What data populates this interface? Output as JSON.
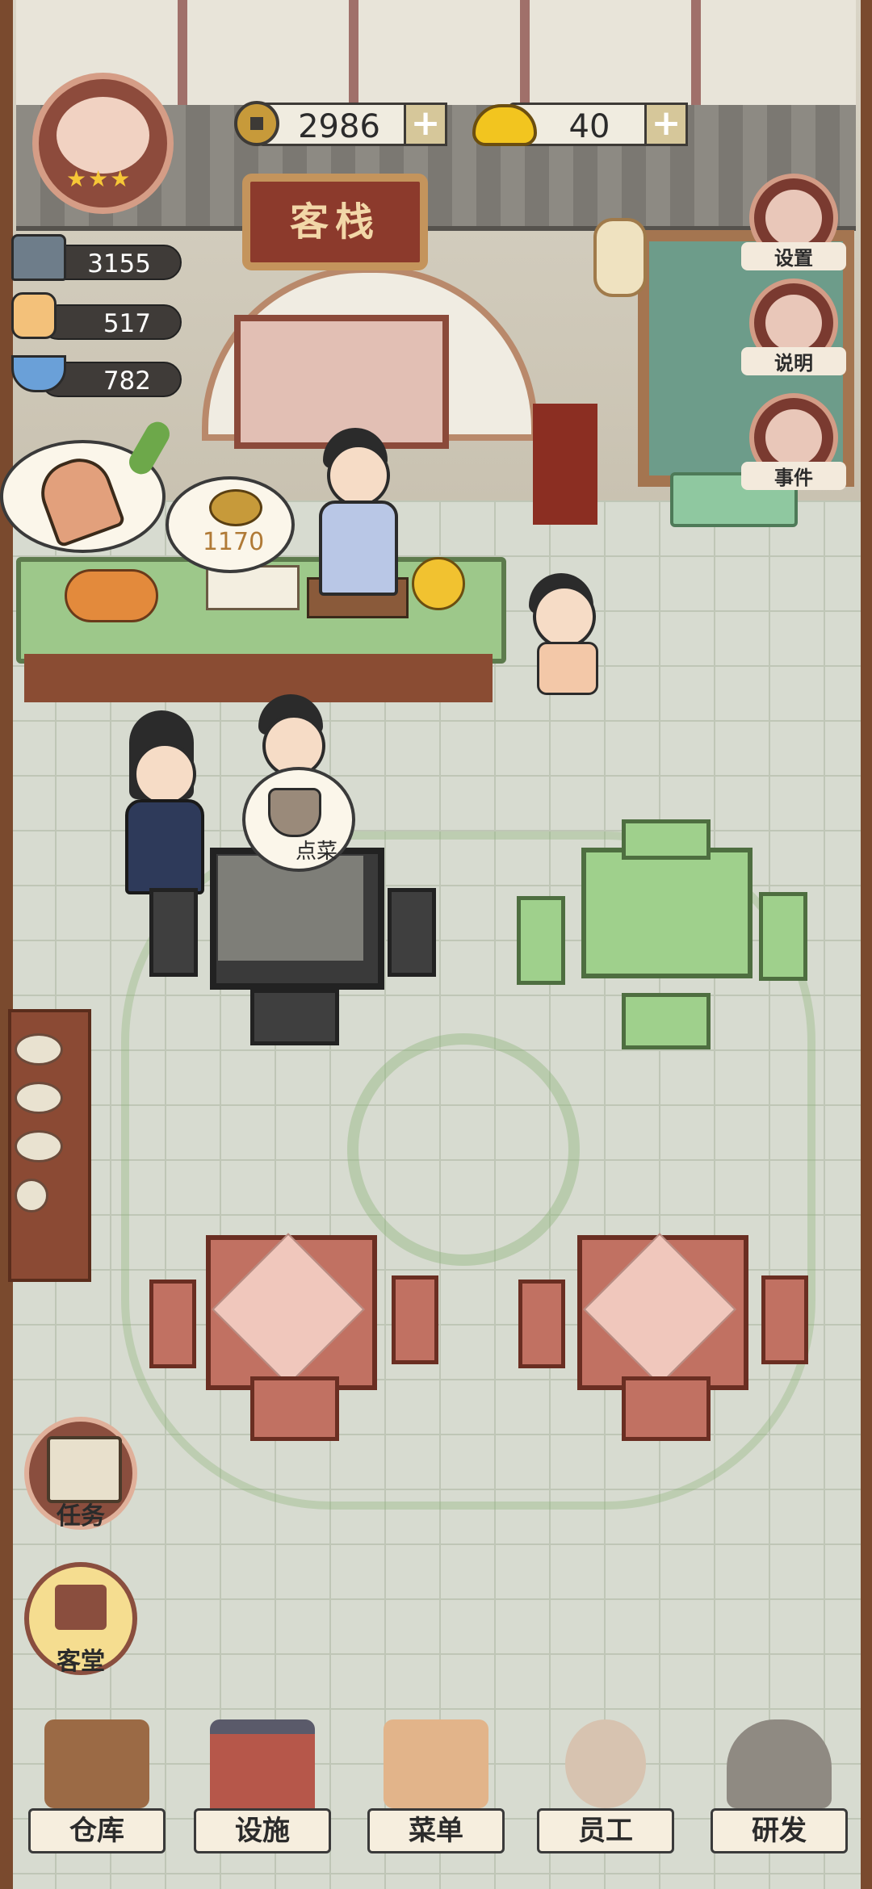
{
  "currency": {
    "coins": "2986",
    "ingots": "40",
    "coin_icon": "copper-coin-icon",
    "ingot_icon": "gold-ingot-icon",
    "plus_icon": "plus-icon"
  },
  "stats": [
    {
      "icon": "building-icon",
      "value": "3155"
    },
    {
      "icon": "thumbs-up-icon",
      "value": "517"
    },
    {
      "icon": "bowl-icon",
      "value": "782"
    }
  ],
  "inn": {
    "sign_text": "客栈",
    "rating_stars": 3
  },
  "right_menu": [
    {
      "label": "设置",
      "icon": "gear-icon"
    },
    {
      "label": "说明",
      "icon": "help-scroll-icon"
    },
    {
      "label": "事件",
      "icon": "event-house-icon"
    }
  ],
  "bubbles": {
    "coin_amount": "1170",
    "order_label": "点菜"
  },
  "side_buttons": [
    {
      "label": "任务",
      "icon": "task-scroll-icon"
    },
    {
      "label": "客堂",
      "icon": "hall-icon"
    }
  ],
  "bottom_nav": [
    {
      "label": "仓库",
      "icon": "warehouse-icon"
    },
    {
      "label": "设施",
      "icon": "facility-icon"
    },
    {
      "label": "菜单",
      "icon": "menu-scroll-icon"
    },
    {
      "label": "员工",
      "icon": "staff-icon"
    },
    {
      "label": "研发",
      "icon": "research-wok-icon"
    }
  ],
  "colors": {
    "accent_brown": "#8d4b3c",
    "coin_text": "#b07a36",
    "counter_green": "#9dc88a"
  }
}
